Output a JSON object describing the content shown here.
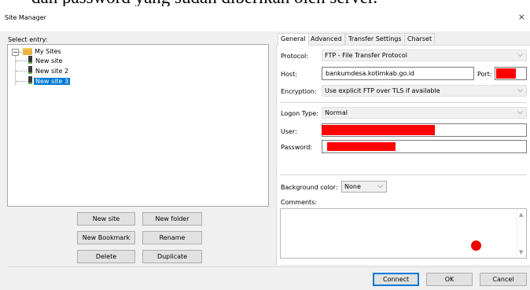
{
  "banner_text": "dan password yang sudah diberikan oleh server.",
  "window": {
    "title": "Site Manager",
    "close_glyph": "×"
  },
  "left": {
    "select_label": "Select entry:",
    "tree": {
      "root": "My Sites",
      "expander": "−",
      "sites": [
        "New site",
        "New site 2",
        "New site 3"
      ],
      "selected_index": 2
    },
    "buttons": {
      "new_site": "New site",
      "new_folder": "New folder",
      "new_bookmark": "New Bookmark",
      "rename": "Rename",
      "delete": "Delete",
      "duplicate": "Duplicate"
    }
  },
  "tabs": [
    "General",
    "Advanced",
    "Transfer Settings",
    "Charset"
  ],
  "active_tab": "General",
  "general": {
    "protocol_label": "Protocol:",
    "protocol_value": "FTP - File Transfer Protocol",
    "host_label": "Host:",
    "host_value": "bankumdesa.kotimkab.go.id",
    "port_label": "Port:",
    "encryption_label": "Encryption:",
    "encryption_value": "Use explicit FTP over TLS if available",
    "logon_type_label": "Logon Type:",
    "logon_type_value": "Normal",
    "user_label": "User:",
    "password_label": "Password:",
    "bg_color_label": "Background color:",
    "bg_color_value": "None",
    "comments_label": "Comments:",
    "chevron_glyph": "⌵"
  },
  "footer": {
    "connect": "Connect",
    "ok": "OK",
    "cancel": "Cancel"
  },
  "colors": {
    "selection": "#0078d7",
    "redaction": "#ff0000",
    "folder": "#e8b340"
  }
}
